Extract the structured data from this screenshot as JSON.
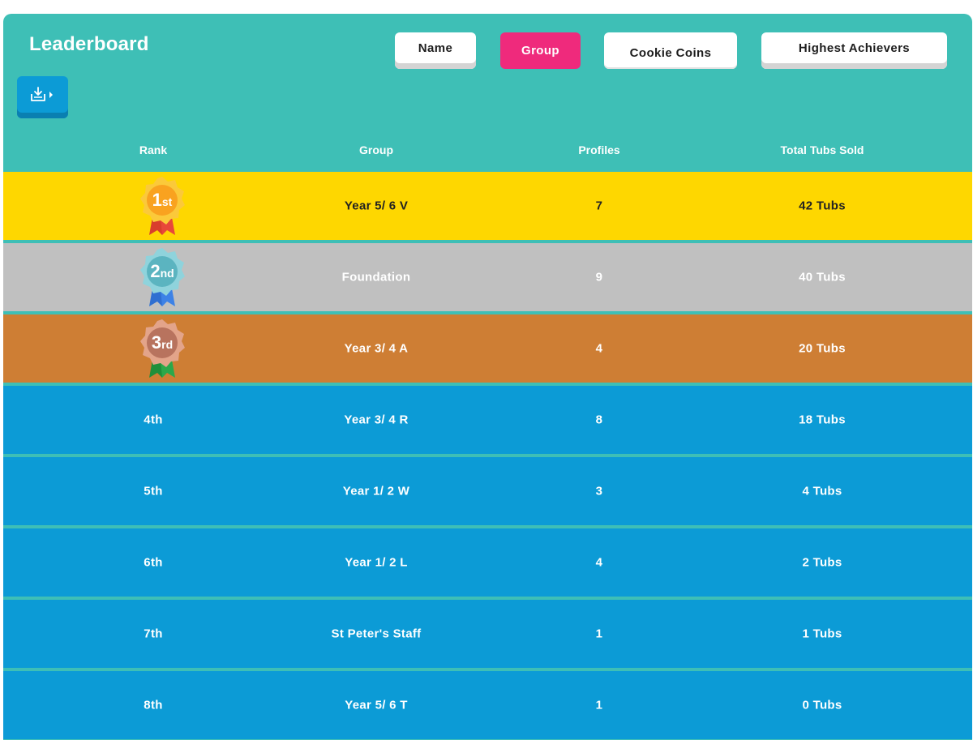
{
  "header": {
    "title": "Leaderboard",
    "tabs": [
      {
        "label": "Name",
        "active": false
      },
      {
        "label": "Group",
        "active": true
      },
      {
        "label": "Cookie Coins",
        "active": false
      },
      {
        "label": "Highest Achievers",
        "active": false
      }
    ],
    "export_icon": "download-tray-icon"
  },
  "table": {
    "columns": [
      "Rank",
      "Group",
      "Profiles",
      "Total Tubs Sold"
    ],
    "rows": [
      {
        "rank": "1st",
        "group": "Year 5/ 6 V",
        "profiles": "7",
        "tubs": "42 Tubs",
        "medal": "gold-medal-icon"
      },
      {
        "rank": "2nd",
        "group": "Foundation",
        "profiles": "9",
        "tubs": "40 Tubs",
        "medal": "silver-medal-icon"
      },
      {
        "rank": "3rd",
        "group": "Year 3/ 4 A",
        "profiles": "4",
        "tubs": "20 Tubs",
        "medal": "bronze-medal-icon"
      },
      {
        "rank": "4th",
        "group": "Year 3/ 4 R",
        "profiles": "8",
        "tubs": "18 Tubs"
      },
      {
        "rank": "5th",
        "group": "Year 1/ 2 W",
        "profiles": "3",
        "tubs": "4 Tubs"
      },
      {
        "rank": "6th",
        "group": "Year 1/ 2 L",
        "profiles": "4",
        "tubs": "2 Tubs"
      },
      {
        "rank": "7th",
        "group": "St Peter's Staff",
        "profiles": "1",
        "tubs": "1 Tubs"
      },
      {
        "rank": "8th",
        "group": "Year 5/ 6 T",
        "profiles": "1",
        "tubs": "0 Tubs"
      }
    ]
  },
  "colors": {
    "panel": "#3ebfb6",
    "active_tab": "#ef2a7c",
    "gold": "#fed700",
    "silver": "#c0c0c0",
    "bronze": "#ce7e34",
    "blue": "#0c9bd6"
  }
}
